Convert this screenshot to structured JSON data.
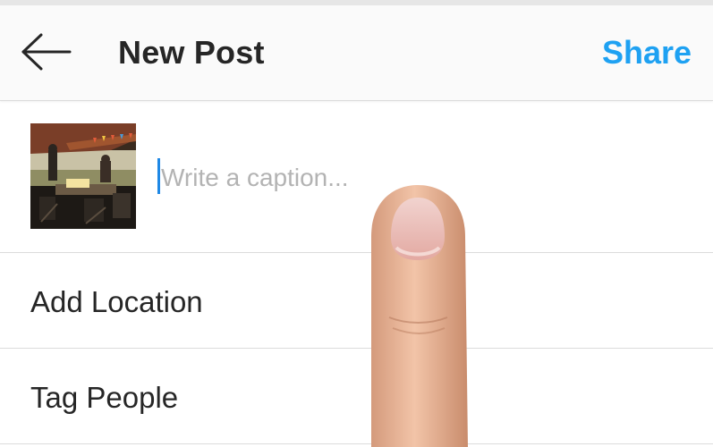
{
  "header": {
    "back_icon": "arrow-left-icon",
    "title": "New Post",
    "share_label": "Share",
    "accent_color": "#1ea1f2"
  },
  "caption": {
    "placeholder": "Write a caption...",
    "value": ""
  },
  "options": [
    {
      "label": "Add Location"
    },
    {
      "label": "Tag People"
    }
  ]
}
